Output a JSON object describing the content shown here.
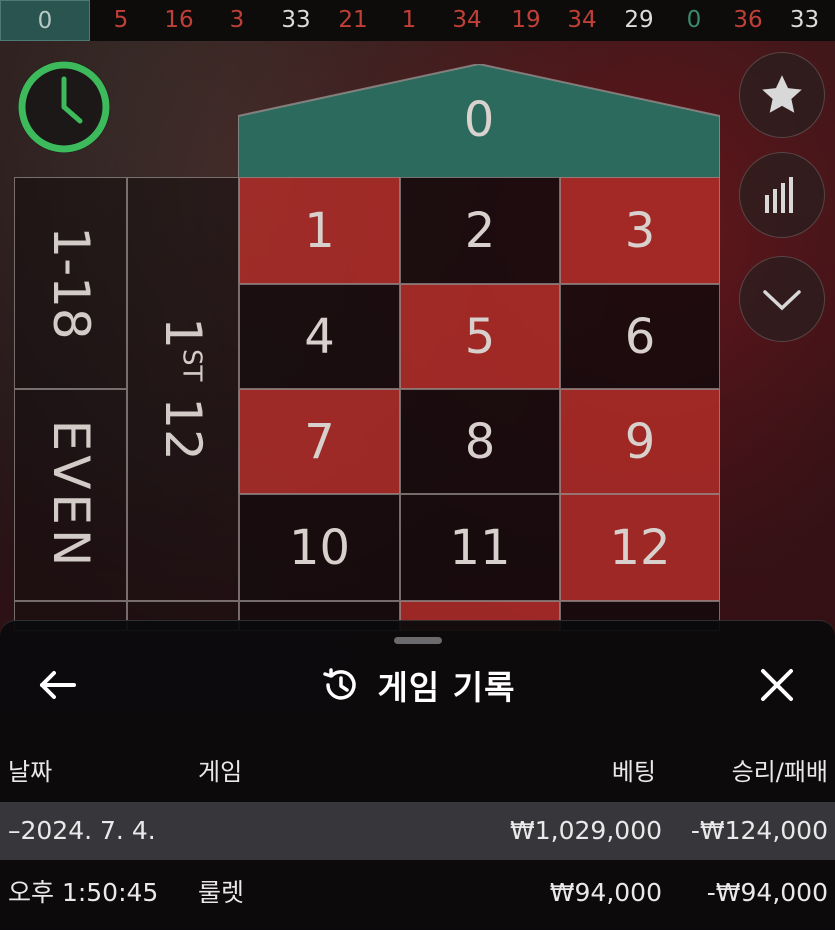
{
  "history": {
    "results": [
      {
        "value": "0",
        "color": "green"
      },
      {
        "value": "5",
        "color": "red"
      },
      {
        "value": "16",
        "color": "red"
      },
      {
        "value": "3",
        "color": "red"
      },
      {
        "value": "33",
        "color": "black"
      },
      {
        "value": "21",
        "color": "red"
      },
      {
        "value": "1",
        "color": "red"
      },
      {
        "value": "34",
        "color": "red"
      },
      {
        "value": "19",
        "color": "red"
      },
      {
        "value": "34",
        "color": "red"
      },
      {
        "value": "29",
        "color": "black"
      },
      {
        "value": "0",
        "color": "green"
      },
      {
        "value": "36",
        "color": "red"
      },
      {
        "value": "33",
        "color": "black"
      }
    ]
  },
  "controls": {
    "timer_icon": "clock-icon",
    "favorite_icon": "star-icon",
    "stats_icon": "bar-chart-icon",
    "collapse_icon": "chevron-down-icon"
  },
  "table": {
    "zero": "0",
    "numbers": [
      {
        "n": "1",
        "color": "red"
      },
      {
        "n": "2",
        "color": "black"
      },
      {
        "n": "3",
        "color": "red"
      },
      {
        "n": "4",
        "color": "black"
      },
      {
        "n": "5",
        "color": "red"
      },
      {
        "n": "6",
        "color": "black"
      },
      {
        "n": "7",
        "color": "red"
      },
      {
        "n": "8",
        "color": "black"
      },
      {
        "n": "9",
        "color": "red"
      },
      {
        "n": "10",
        "color": "black"
      },
      {
        "n": "11",
        "color": "black"
      },
      {
        "n": "12",
        "color": "red"
      }
    ],
    "outside": {
      "low": "1-18",
      "even": "EVEN",
      "dozen_first": "1",
      "dozen_suffix": "ST",
      "dozen_word": "12"
    }
  },
  "sheet": {
    "back_icon": "arrow-left-icon",
    "history_icon": "history-icon",
    "close_icon": "close-icon",
    "title": "게임 기록",
    "columns": {
      "date": "날짜",
      "game": "게임",
      "bet": "베팅",
      "result": "승리/패배"
    },
    "summary": {
      "date": "–2024. 7. 4.",
      "bet": "₩1,029,000",
      "result": "-₩124,000"
    },
    "entries": [
      {
        "time": "오후 1:50:45",
        "game": "룰렛",
        "bet": "₩94,000",
        "result": "-₩94,000"
      }
    ]
  },
  "colors": {
    "red": "#af2d28",
    "black": "#120a0c",
    "green": "#2a6e5e",
    "timer": "#3dbb5c"
  }
}
